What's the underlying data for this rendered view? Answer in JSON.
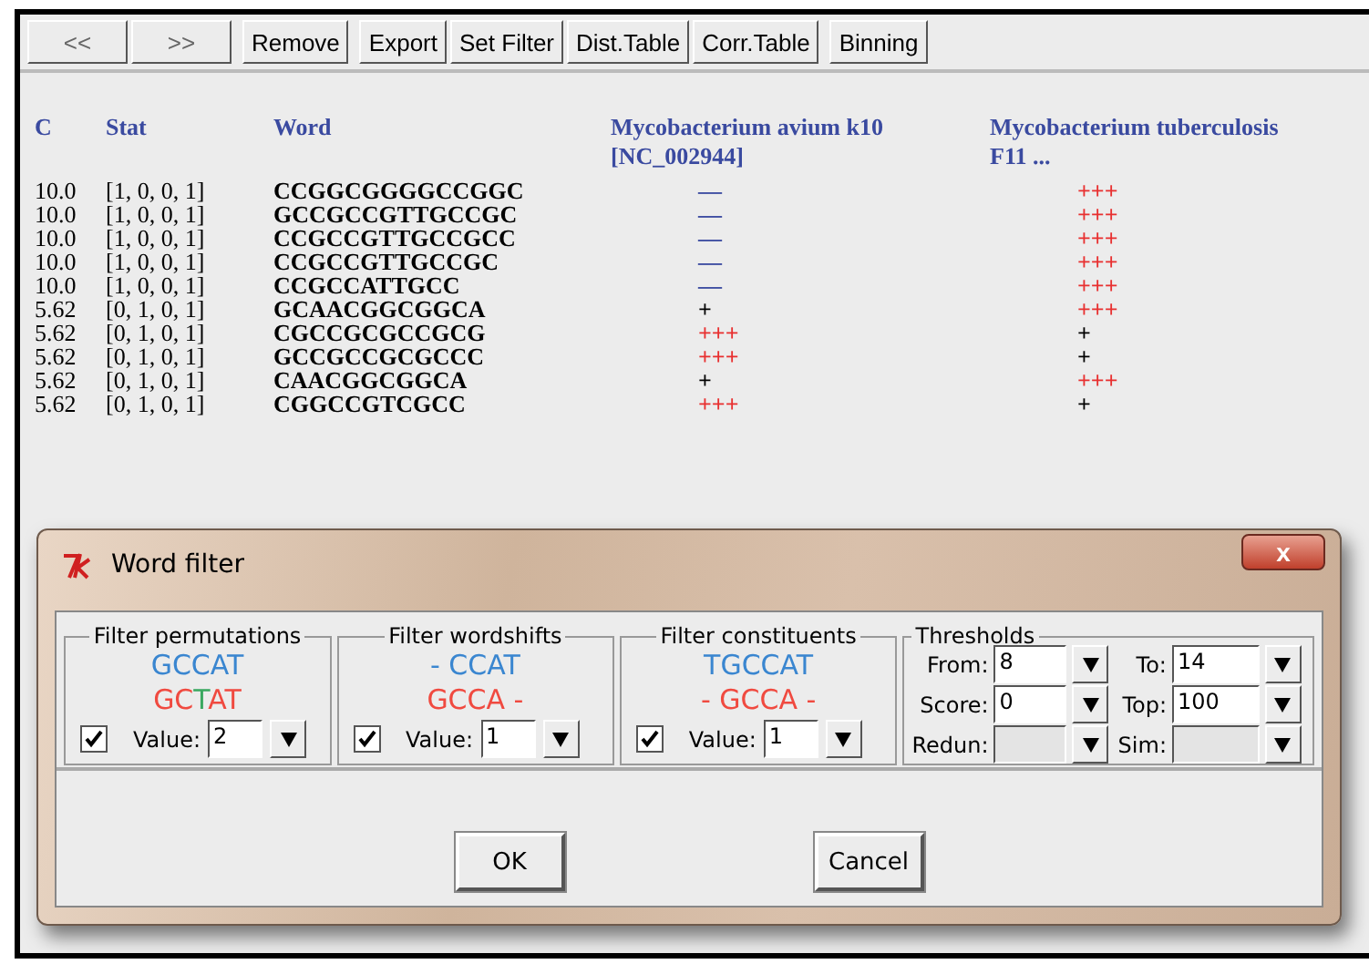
{
  "toolbar": {
    "buttons": [
      "<<",
      ">>",
      "Remove",
      "Export",
      "Set Filter",
      "Dist.Table",
      "Corr.Table",
      "Binning"
    ]
  },
  "table": {
    "columns": [
      "C",
      "Stat",
      "Word",
      "Mycobacterium avium k10 [NC_002944]",
      "Mycobacterium tuberculosis F11 ..."
    ],
    "rows": [
      {
        "c": "10.0",
        "stat": "[1, 0, 0, 1]",
        "word": "CCGGCGGGGCCGGC",
        "cells": [
          {
            "text": "—",
            "color": "#3a4aa0"
          },
          {
            "text": "+++",
            "color": "#e83030"
          }
        ]
      },
      {
        "c": "10.0",
        "stat": "[1, 0, 0, 1]",
        "word": "GCCGCCGTTGCCGC",
        "cells": [
          {
            "text": "—",
            "color": "#3a4aa0"
          },
          {
            "text": "+++",
            "color": "#e83030"
          }
        ]
      },
      {
        "c": "10.0",
        "stat": "[1, 0, 0, 1]",
        "word": "CCGCCGTTGCCGCC",
        "cells": [
          {
            "text": "—",
            "color": "#3a4aa0"
          },
          {
            "text": "+++",
            "color": "#e83030"
          }
        ]
      },
      {
        "c": "10.0",
        "stat": "[1, 0, 0, 1]",
        "word": "CCGCCGTTGCCGC",
        "cells": [
          {
            "text": "—",
            "color": "#3a4aa0"
          },
          {
            "text": "+++",
            "color": "#e83030"
          }
        ]
      },
      {
        "c": "10.0",
        "stat": "[1, 0, 0, 1]",
        "word": "CCGCCATTGCC",
        "cells": [
          {
            "text": "—",
            "color": "#3a4aa0"
          },
          {
            "text": "+++",
            "color": "#e83030"
          }
        ]
      },
      {
        "c": "5.62",
        "stat": "[0, 1, 0, 1]",
        "word": "GCAACGGCGGCA",
        "cells": [
          {
            "text": "+",
            "color": "#000000"
          },
          {
            "text": "+++",
            "color": "#e83030"
          }
        ]
      },
      {
        "c": "5.62",
        "stat": "[0, 1, 0, 1]",
        "word": "CGCCGCGCCGCG",
        "cells": [
          {
            "text": "+++",
            "color": "#e83030"
          },
          {
            "text": "+",
            "color": "#000000"
          }
        ]
      },
      {
        "c": "5.62",
        "stat": "[0, 1, 0, 1]",
        "word": "GCCGCCGCGCCC",
        "cells": [
          {
            "text": "+++",
            "color": "#e83030"
          },
          {
            "text": "+",
            "color": "#000000"
          }
        ]
      },
      {
        "c": "5.62",
        "stat": "[0, 1, 0, 1]",
        "word": "CAACGGCGGCA",
        "cells": [
          {
            "text": "+",
            "color": "#000000"
          },
          {
            "text": "+++",
            "color": "#e83030"
          }
        ]
      },
      {
        "c": "5.62",
        "stat": "[0, 1, 0, 1]",
        "word": "CGGCCGTCGCC",
        "cells": [
          {
            "text": "+++",
            "color": "#e83030"
          },
          {
            "text": "+",
            "color": "#000000"
          }
        ]
      }
    ]
  },
  "dialog": {
    "title": "Word filter",
    "close": "x",
    "groups": [
      {
        "title": "Filter permutations",
        "top": [
          {
            "text": "GCCAT",
            "color": "#3a86d0"
          }
        ],
        "bottom": [
          {
            "text": "GC",
            "color": "#f04a40"
          },
          {
            "text": "T",
            "color": "#3aa860"
          },
          {
            "text": "AT",
            "color": "#f04a40"
          }
        ],
        "checked": true,
        "label": "Value:",
        "value": "2"
      },
      {
        "title": "Filter wordshifts",
        "top": [
          {
            "text": "- CCAT",
            "color": "#3a86d0"
          }
        ],
        "bottom": [
          {
            "text": "GCCA -",
            "color": "#f04a40"
          }
        ],
        "checked": true,
        "label": "Value:",
        "value": "1"
      },
      {
        "title": "Filter constituents",
        "top": [
          {
            "text": "TGCCAT",
            "color": "#3a86d0"
          }
        ],
        "bottom": [
          {
            "text": "- GCCA -",
            "color": "#f04a40"
          }
        ],
        "checked": true,
        "label": "Value:",
        "value": "1"
      }
    ],
    "thresholds": {
      "title": "Thresholds",
      "fields": [
        {
          "label": "From:",
          "value": "8",
          "disabled": false
        },
        {
          "label": "To:",
          "value": "14",
          "disabled": false
        },
        {
          "label": "Score:",
          "value": "0",
          "disabled": false
        },
        {
          "label": "Top:",
          "value": "100",
          "disabled": false
        },
        {
          "label": "Redun:",
          "disabled": true
        },
        {
          "label": "Sim:",
          "disabled": true
        }
      ]
    },
    "buttons": [
      "OK",
      "Cancel"
    ]
  }
}
